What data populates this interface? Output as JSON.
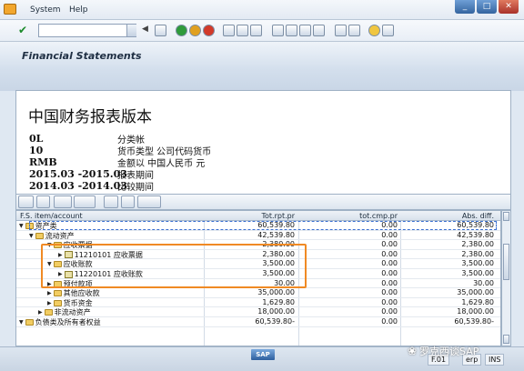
{
  "menu": {
    "system": "System",
    "help": "Help"
  },
  "page_title": "Financial Statements",
  "header": {
    "title": "中国财务报表版本",
    "rows": [
      {
        "key": "0L",
        "value": "分类帐"
      },
      {
        "key": "10",
        "value": "货币类型  公司代码货币"
      },
      {
        "key": "RMB",
        "value": "金额以  中国人民币  元"
      },
      {
        "key": "2015.03 -2015.03",
        "value": "报表期间"
      },
      {
        "key": "2014.03 -2014.03",
        "value": "比较期间"
      }
    ]
  },
  "grid": {
    "columns": [
      "F.S. item/account",
      "Tot.rpt.pr",
      "tot.cmp.pr",
      "Abs. diff."
    ],
    "rows": [
      {
        "label": "资产类",
        "tot_rpt": "60,539.80",
        "tot_cmp": "0.00",
        "abs_diff": "60,539.80"
      },
      {
        "label": "流动资产",
        "tot_rpt": "42,539.80",
        "tot_cmp": "0.00",
        "abs_diff": "42,539.80"
      },
      {
        "label": "应收票据",
        "tot_rpt": "2,380.00",
        "tot_cmp": "0.00",
        "abs_diff": "2,380.00"
      },
      {
        "label": "11210101 应收票据",
        "tot_rpt": "2,380.00",
        "tot_cmp": "0.00",
        "abs_diff": "2,380.00"
      },
      {
        "label": "应收账款",
        "tot_rpt": "3,500.00",
        "tot_cmp": "0.00",
        "abs_diff": "3,500.00"
      },
      {
        "label": "11220101 应收账款",
        "tot_rpt": "3,500.00",
        "tot_cmp": "0.00",
        "abs_diff": "3,500.00"
      },
      {
        "label": "预付款项",
        "tot_rpt": "30.00",
        "tot_cmp": "0.00",
        "abs_diff": "30.00"
      },
      {
        "label": "其他应收款",
        "tot_rpt": "35,000.00",
        "tot_cmp": "0.00",
        "abs_diff": "35,000.00"
      },
      {
        "label": "货币资金",
        "tot_rpt": "1,629.80",
        "tot_cmp": "0.00",
        "abs_diff": "1,629.80"
      },
      {
        "label": "非流动资产",
        "tot_rpt": "18,000.00",
        "tot_cmp": "0.00",
        "abs_diff": "18,000.00"
      },
      {
        "label": "负债类及所有者权益",
        "tot_rpt": "60,539.80-",
        "tot_cmp": "0.00",
        "abs_diff": "60,539.80-"
      }
    ]
  },
  "status": {
    "sap_logo": "SAP",
    "field1": "F.01",
    "field2": "erp",
    "field3": "INS"
  },
  "watermark": "罗克西谈SAP"
}
